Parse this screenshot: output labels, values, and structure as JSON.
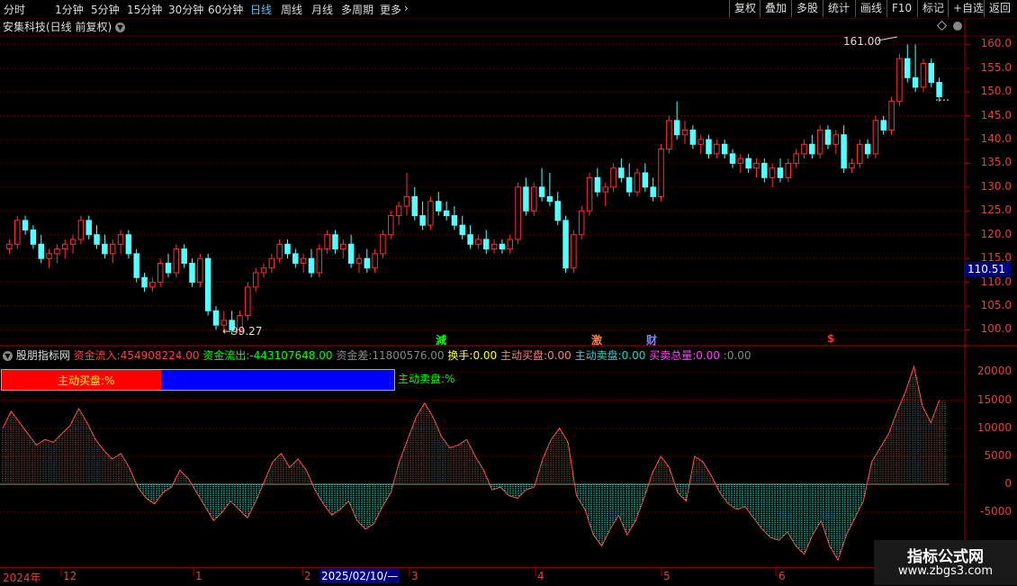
{
  "toolbar": {
    "periods": [
      "分时",
      "1分钟",
      "5分钟",
      "15分钟",
      "30分钟",
      "60分钟",
      "日线",
      "周线",
      "月线",
      "多周期",
      "更多"
    ],
    "active_period": "日线",
    "buttons": [
      "复权",
      "叠加",
      "多股",
      "统计",
      "画线",
      "F10",
      "标记",
      "+自选",
      "返回"
    ]
  },
  "stock_title": "安集科技(日线 前复权)",
  "price_axis": [
    "160.0",
    "155.0",
    "150.0",
    "145.0",
    "140.0",
    "135.0",
    "130.0",
    "125.0",
    "120.0",
    "115.0",
    "110.0",
    "105.0",
    "100.0"
  ],
  "current_price": "110.51",
  "annotations": {
    "high": "161.00",
    "low": "99.27"
  },
  "event_markers": [
    "減",
    "激",
    "财",
    "$"
  ],
  "indicator": {
    "name": "股朋指标网",
    "inflow_label": "资金流入:",
    "inflow_value": "454908224.00",
    "outflow_label": "资金流出:",
    "outflow_value": "-443107648.00",
    "diff_label": "资金差:",
    "diff_value": "11800576.00",
    "turnover_label": "换手:",
    "turnover_value": "0.00",
    "buy_label": "主动买盘:",
    "buy_value": "0.00",
    "sell_label": "主动卖盘:",
    "sell_value": "0.00",
    "total_label": "买卖总量:",
    "total_value": "0.00",
    "extra_label": ":",
    "extra_value": "0.00",
    "buy_pct_label": "主动买盘:%",
    "sell_pct_label": "主动卖盘:%",
    "buy_ratio": 0.405
  },
  "indicator_axis": [
    "20000",
    "15000",
    "10000",
    "5000",
    "0",
    "-5000"
  ],
  "timeline": {
    "labels": [
      "2024年",
      "12",
      "1",
      "2",
      "3",
      "4",
      "5",
      "6"
    ],
    "cursor": "2025/02/10/—"
  },
  "watermark": {
    "title": "指标公式网",
    "url": "www.zbgs3.com"
  },
  "colors": {
    "up": "#ff3030",
    "down": "#54ffff",
    "grid": "#7a0000",
    "axis_text": "#e04040"
  },
  "chart_data": {
    "type": "candlestick",
    "ylim": [
      97,
      163
    ],
    "candles": [
      [
        117,
        119,
        116,
        118
      ],
      [
        118,
        124,
        117,
        123
      ],
      [
        123,
        124,
        120,
        121
      ],
      [
        121,
        122,
        117,
        118
      ],
      [
        118,
        120,
        114,
        115
      ],
      [
        115,
        117,
        113,
        116
      ],
      [
        116,
        118,
        114,
        117
      ],
      [
        117,
        119,
        115,
        118
      ],
      [
        118,
        120,
        116,
        119
      ],
      [
        119,
        124,
        118,
        123
      ],
      [
        123,
        124,
        119,
        120
      ],
      [
        120,
        122,
        117,
        118
      ],
      [
        118,
        120,
        115,
        116
      ],
      [
        116,
        119,
        114,
        118
      ],
      [
        118,
        121,
        116,
        120
      ],
      [
        120,
        121,
        115,
        116
      ],
      [
        116,
        117,
        110,
        111
      ],
      [
        111,
        112,
        108,
        109
      ],
      [
        109,
        111,
        108,
        110
      ],
      [
        110,
        115,
        109,
        114
      ],
      [
        114,
        116,
        111,
        112
      ],
      [
        112,
        118,
        111,
        117
      ],
      [
        117,
        118,
        113,
        114
      ],
      [
        114,
        115,
        109,
        110
      ],
      [
        110,
        116,
        109,
        115
      ],
      [
        115,
        116,
        103,
        104
      ],
      [
        104,
        105,
        100,
        101
      ],
      [
        101,
        104,
        100,
        102
      ],
      [
        102,
        104,
        99,
        100
      ],
      [
        100,
        104,
        99,
        103
      ],
      [
        103,
        110,
        102,
        109
      ],
      [
        109,
        113,
        108,
        112
      ],
      [
        112,
        114,
        111,
        113
      ],
      [
        113,
        116,
        112,
        115
      ],
      [
        115,
        119,
        114,
        118
      ],
      [
        118,
        119,
        115,
        116
      ],
      [
        116,
        117,
        113,
        114
      ],
      [
        114,
        116,
        112,
        115
      ],
      [
        115,
        117,
        111,
        112
      ],
      [
        112,
        118,
        111,
        117
      ],
      [
        117,
        121,
        116,
        120
      ],
      [
        120,
        121,
        116,
        117
      ],
      [
        117,
        119,
        115,
        118
      ],
      [
        118,
        120,
        113,
        114
      ],
      [
        114,
        116,
        112,
        115
      ],
      [
        115,
        117,
        112,
        113
      ],
      [
        113,
        117,
        112,
        116
      ],
      [
        116,
        121,
        115,
        120
      ],
      [
        120,
        125,
        119,
        124
      ],
      [
        124,
        127,
        122,
        126
      ],
      [
        126,
        133,
        124,
        128
      ],
      [
        128,
        130,
        123,
        124
      ],
      [
        124,
        127,
        121,
        122
      ],
      [
        122,
        128,
        121,
        127
      ],
      [
        127,
        129,
        124,
        125
      ],
      [
        125,
        127,
        123,
        124
      ],
      [
        124,
        126,
        121,
        122
      ],
      [
        122,
        124,
        119,
        120
      ],
      [
        120,
        122,
        117,
        118
      ],
      [
        118,
        120,
        117,
        119
      ],
      [
        119,
        121,
        116,
        117
      ],
      [
        117,
        119,
        116,
        118
      ],
      [
        118,
        119,
        116,
        117
      ],
      [
        117,
        120,
        116,
        119
      ],
      [
        119,
        131,
        118,
        130
      ],
      [
        130,
        132,
        124,
        125
      ],
      [
        125,
        131,
        124,
        130
      ],
      [
        130,
        134,
        127,
        128
      ],
      [
        128,
        133,
        126,
        127
      ],
      [
        127,
        129,
        122,
        123
      ],
      [
        123,
        124,
        112,
        113
      ],
      [
        113,
        121,
        112,
        120
      ],
      [
        120,
        126,
        119,
        125
      ],
      [
        125,
        133,
        124,
        132
      ],
      [
        132,
        134,
        128,
        129
      ],
      [
        129,
        131,
        126,
        130
      ],
      [
        130,
        135,
        129,
        134
      ],
      [
        134,
        136,
        131,
        132
      ],
      [
        132,
        135,
        128,
        129
      ],
      [
        129,
        134,
        128,
        133
      ],
      [
        133,
        135,
        129,
        130
      ],
      [
        130,
        132,
        127,
        128
      ],
      [
        128,
        139,
        127,
        138
      ],
      [
        138,
        145,
        137,
        144
      ],
      [
        144,
        148,
        140,
        141
      ],
      [
        141,
        144,
        139,
        142
      ],
      [
        142,
        143,
        138,
        139
      ],
      [
        139,
        141,
        137,
        140
      ],
      [
        140,
        141,
        136,
        137
      ],
      [
        137,
        140,
        136,
        139
      ],
      [
        139,
        140,
        136,
        137
      ],
      [
        137,
        138,
        134,
        135
      ],
      [
        135,
        137,
        133,
        136
      ],
      [
        136,
        137,
        133,
        134
      ],
      [
        134,
        136,
        132,
        135
      ],
      [
        135,
        136,
        131,
        132
      ],
      [
        132,
        135,
        130,
        134
      ],
      [
        134,
        136,
        131,
        132
      ],
      [
        132,
        136,
        131,
        135
      ],
      [
        135,
        138,
        134,
        137
      ],
      [
        137,
        140,
        136,
        139
      ],
      [
        139,
        141,
        136,
        137
      ],
      [
        137,
        143,
        136,
        142
      ],
      [
        142,
        143,
        138,
        139
      ],
      [
        139,
        142,
        137,
        141
      ],
      [
        141,
        143,
        133,
        134
      ],
      [
        134,
        136,
        133,
        135
      ],
      [
        135,
        140,
        134,
        139
      ],
      [
        139,
        140,
        136,
        137
      ],
      [
        137,
        145,
        136,
        144
      ],
      [
        144,
        145,
        141,
        142
      ],
      [
        142,
        149,
        141,
        148
      ],
      [
        148,
        158,
        147,
        157
      ],
      [
        157,
        160,
        152,
        153
      ],
      [
        153,
        160,
        150,
        151
      ],
      [
        151,
        157,
        150,
        156
      ],
      [
        156,
        157,
        151,
        152
      ],
      [
        152,
        153,
        148,
        149
      ]
    ],
    "volume_diff": [
      10000,
      13000,
      11000,
      9000,
      7000,
      8000,
      7500,
      9000,
      10500,
      13500,
      11000,
      8000,
      6000,
      4500,
      5500,
      3000,
      -500,
      -2500,
      -3500,
      -1500,
      -500,
      2500,
      1000,
      -1500,
      -4000,
      -6500,
      -5000,
      -3000,
      -4500,
      -6000,
      -3000,
      500,
      4000,
      5500,
      3000,
      4500,
      2500,
      -1000,
      -3500,
      -5500,
      -4500,
      -3000,
      -6500,
      -8000,
      -7000,
      -4000,
      -1500,
      4000,
      8000,
      12000,
      14500,
      12000,
      8500,
      6500,
      7000,
      8000,
      5000,
      2500,
      -1000,
      -500,
      -2000,
      -2500,
      -1000,
      -500,
      4500,
      8000,
      10000,
      7500,
      -2000,
      -4500,
      -9000,
      -11000,
      -8000,
      -5500,
      -9000,
      -6500,
      -2500,
      2000,
      5000,
      3000,
      -1500,
      -3000,
      5000,
      4000,
      1500,
      -1500,
      -3500,
      -4500,
      -4000,
      -6000,
      -8000,
      -9500,
      -10000,
      -8500,
      -11000,
      -12500,
      -9000,
      -6500,
      -11000,
      -13500,
      -9000,
      -6000,
      -3000,
      4000,
      6500,
      9000,
      13000,
      16500,
      21000,
      14000,
      11000,
      15000
    ]
  }
}
